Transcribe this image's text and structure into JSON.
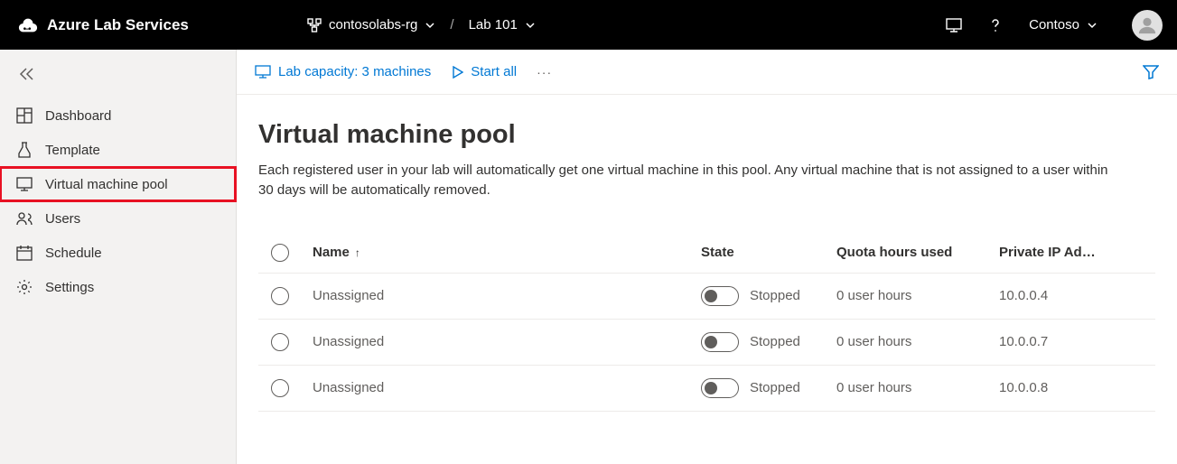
{
  "header": {
    "app_name": "Azure Lab Services",
    "breadcrumb": {
      "rg": "contosolabs-rg",
      "lab": "Lab 101",
      "sep": "/"
    },
    "user": "Contoso"
  },
  "sidebar": {
    "items": [
      {
        "label": "Dashboard"
      },
      {
        "label": "Template"
      },
      {
        "label": "Virtual machine pool"
      },
      {
        "label": "Users"
      },
      {
        "label": "Schedule"
      },
      {
        "label": "Settings"
      }
    ]
  },
  "toolbar": {
    "capacity": "Lab capacity: 3 machines",
    "start_all": "Start all",
    "more": "···"
  },
  "page": {
    "title": "Virtual machine pool",
    "description": "Each registered user in your lab will automatically get one virtual machine in this pool. Any virtual machine that is not assigned to a user within 30 days will be automatically removed."
  },
  "table": {
    "columns": {
      "name": "Name",
      "state": "State",
      "quota": "Quota hours used",
      "ip": "Private IP Ad…"
    },
    "sort_indicator": "↑",
    "rows": [
      {
        "name": "Unassigned",
        "state": "Stopped",
        "quota": "0 user hours",
        "ip": "10.0.0.4"
      },
      {
        "name": "Unassigned",
        "state": "Stopped",
        "quota": "0 user hours",
        "ip": "10.0.0.7"
      },
      {
        "name": "Unassigned",
        "state": "Stopped",
        "quota": "0 user hours",
        "ip": "10.0.0.8"
      }
    ]
  }
}
